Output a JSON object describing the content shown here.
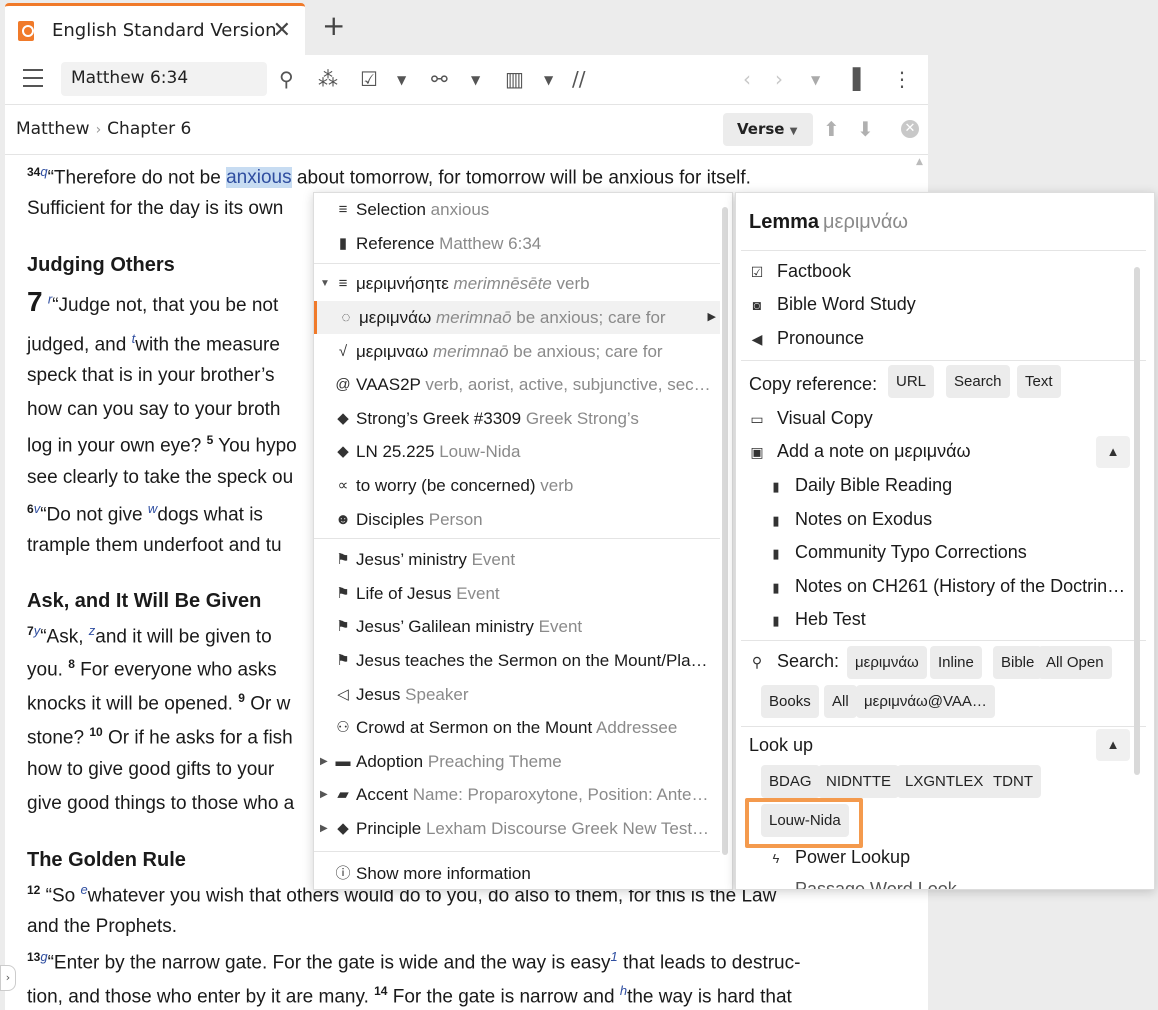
{
  "tab": {
    "title": "English Standard Version"
  },
  "toolbar": {
    "reference": "Matthew 6:34"
  },
  "breadcrumb": {
    "book": "Matthew",
    "chapter": "Chapter 6"
  },
  "nav": {
    "verse_label": "Verse"
  },
  "text": {
    "v34_num": "34",
    "v34_fn": "q",
    "v34_a": "“Therefore do not be ",
    "v34_hl": "anxious",
    "v34_b": " about tomorrow, for tomorrow will be anxious for itself.",
    "v34_line2": "Sufficient for the day is its own",
    "h1": "Judging Others",
    "c7": "7",
    "v1_fn": "r",
    "v1_a": "“Judge not, that you be not",
    "l2_a": "judged, and ",
    "l2_fn": "t",
    "l2_b": "with the measure",
    "l3": "speck that is in your brother’s",
    "l4": "how can you say to your broth",
    "l5_a": "log in your own eye? ",
    "l5_num": "5",
    "l5_b": " You hypo",
    "l6": "see clearly to take the speck ou",
    "l7_num": "6",
    "l7_fn": "v",
    "l7_a": "“Do not give ",
    "l7_fn2": "w",
    "l7_b": "dogs what is",
    "l8": "trample them underfoot and tu",
    "h2": "Ask, and It Will Be Given",
    "l9_num": "7",
    "l9_fn": "y",
    "l9_a": "“Ask, ",
    "l9_fn2": "z",
    "l9_b": "and it will be given to",
    "l10_a": "you. ",
    "l10_num": "8",
    "l10_b": " For everyone who asks",
    "l11_a": "knocks it will be opened. ",
    "l11_num": "9",
    "l11_b": " Or w",
    "l12_a": "stone? ",
    "l12_num": "10",
    "l12_b": " Or if he asks for a fish",
    "l13": "how to give good gifts to your",
    "l14": "give good things to those who a",
    "h3": "The Golden Rule",
    "l15_num": "12",
    "l15_a": " “So ",
    "l15_fn": "e",
    "l15_b": "whatever you wish that others would do to you, do also to them, for this is the Law",
    "l16": "and the Prophets.",
    "l17_num": "13",
    "l17_fn": "g",
    "l17_a": "“Enter by the narrow gate. For the gate is wide and the way is easy",
    "l17_fn2": "1",
    "l17_b": " that leads to destruc-",
    "l18_a": "tion, and those who enter by it are many. ",
    "l18_num": "14",
    "l18_b": " For the gate is narrow and ",
    "l18_fn": "h",
    "l18_b2": "the way is hard that"
  },
  "context_menu": {
    "items": [
      {
        "label": "Selection",
        "detail": "anxious"
      },
      {
        "label": "Reference",
        "detail": "Matthew 6:34"
      },
      {
        "label": "μεριμνήσητε",
        "detail": "merimnēsēte",
        "extra": "verb"
      },
      {
        "label": "μεριμνάω",
        "detail": "merimnaō",
        "extra": "be anxious; care for"
      },
      {
        "label": "μεριμναω",
        "detail": "merimnaō",
        "extra": "be anxious; care for"
      },
      {
        "label": "VAAS2P",
        "detail": "verb, aorist, active, subjunctive, sec…"
      },
      {
        "label": "Strong’s Greek #3309",
        "detail": "Greek Strong’s"
      },
      {
        "label": "LN 25.225",
        "detail": "Louw-Nida"
      },
      {
        "label": "to worry (be concerned)",
        "detail": "verb"
      },
      {
        "label": "Disciples",
        "detail": "Person"
      },
      {
        "label": "Jesus’ ministry",
        "detail": "Event"
      },
      {
        "label": "Life of Jesus",
        "detail": "Event"
      },
      {
        "label": "Jesus’ Galilean ministry",
        "detail": "Event"
      },
      {
        "label": "Jesus teaches the Sermon on the Mount/Pla…",
        "detail": ""
      },
      {
        "label": "Jesus",
        "detail": "Speaker"
      },
      {
        "label": "Crowd at Sermon on the Mount",
        "detail": "Addressee"
      },
      {
        "label": "Adoption",
        "detail": "Preaching Theme"
      },
      {
        "label": "Accent",
        "detail": "Name: Proparoxytone, Position: Ante…"
      },
      {
        "label": "Principle",
        "detail": "Lexham Discourse Greek New Test…"
      },
      {
        "label": "Show more information",
        "detail": ""
      }
    ]
  },
  "side": {
    "title": "Lemma",
    "title_greek": "μεριμνάω",
    "factbook": "Factbook",
    "bws": "Bible Word Study",
    "pronounce": "Pronounce",
    "copy_ref": "Copy reference:",
    "chip_url": "URL",
    "chip_search": "Search",
    "chip_text": "Text",
    "visual_copy": "Visual Copy",
    "add_note": "Add a note on μεριμνάω",
    "notes": [
      "Daily Bible Reading",
      "Notes on Exodus",
      "Community Typo Corrections",
      "Notes on CH261 (History of the Doctrin…",
      "Heb Test"
    ],
    "search_label": "Search:",
    "search_chips": [
      "μεριμνάω",
      "Inline",
      "Bible",
      "All Open",
      "Books",
      "All",
      "μεριμνάω@VAA…"
    ],
    "lookup": "Look up",
    "lookup_chips": [
      "BDAG",
      "NIDNTTE",
      "LXGNTLEX",
      "TDNT",
      "Louw-Nida"
    ],
    "power_lookup": "Power Lookup",
    "cut_off": "Passage Word Look…"
  }
}
